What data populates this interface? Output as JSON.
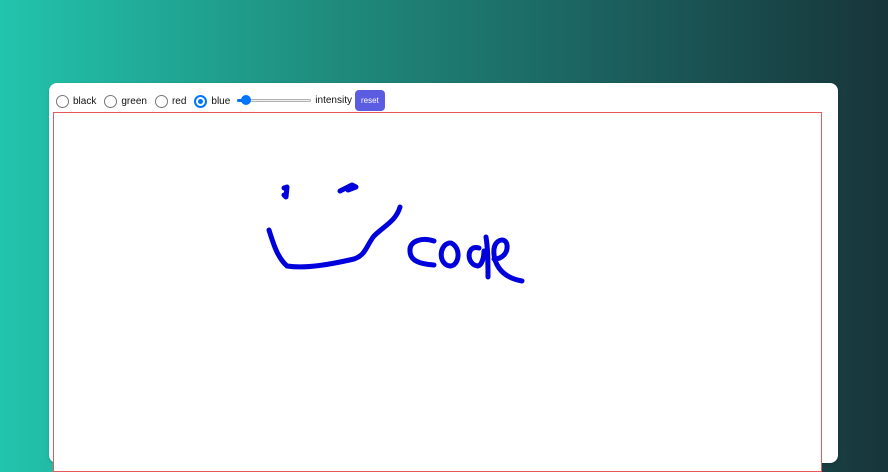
{
  "toolbar": {
    "colors": [
      {
        "label": "black",
        "checked": false
      },
      {
        "label": "green",
        "checked": false
      },
      {
        "label": "red",
        "checked": false
      },
      {
        "label": "blue",
        "checked": true
      }
    ],
    "intensity_label": "intensity",
    "intensity_value": 0.12,
    "reset_label": "reset"
  },
  "canvas": {
    "stroke_color": "#0000dd",
    "border_color": "#e85a5a"
  },
  "colors": {
    "accent": "#0075ff",
    "button": "#5b5ce2"
  }
}
